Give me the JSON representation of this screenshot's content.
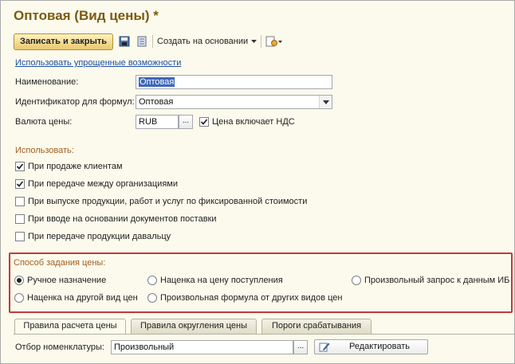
{
  "window": {
    "title": "Оптовая (Вид цены) *"
  },
  "toolbar": {
    "save_close_label": "Записать и закрыть",
    "create_based_label": "Создать на основании",
    "icons": [
      "save-icon",
      "list-icon",
      "create-based-dropdown-icon",
      "report-icon"
    ]
  },
  "simple_mode_link": "Использовать упрощенные возможности",
  "fields": {
    "name_label": "Наименование:",
    "name_value": "Оптовая",
    "formula_id_label": "Идентификатор для формул:",
    "formula_id_value": "Оптовая",
    "currency_label": "Валюта цены:",
    "currency_value": "RUB",
    "currency_dots": "...",
    "vat_label": "Цена включает НДС",
    "vat_checked": true
  },
  "use_section": {
    "title": "Использовать:",
    "items": [
      {
        "label": "При продаже клиентам",
        "checked": true
      },
      {
        "label": "При передаче между организациями",
        "checked": true
      },
      {
        "label": "При выпуске продукции, работ и услуг по фиксированной стоимости",
        "checked": false
      },
      {
        "label": "При вводе на основании документов поставки",
        "checked": false
      },
      {
        "label": "При передаче продукции давальцу",
        "checked": false
      }
    ]
  },
  "price_method": {
    "title": "Способ задания цены:",
    "options": [
      {
        "label": "Ручное назначение",
        "selected": true
      },
      {
        "label": "Наценка на цену поступления",
        "selected": false
      },
      {
        "label": "Произвольный запрос к данным ИБ",
        "selected": false
      },
      {
        "label": "Наценка на другой вид цен",
        "selected": false
      },
      {
        "label": "Произвольная формула от других видов цен",
        "selected": false
      }
    ]
  },
  "tabs": [
    {
      "label": "Правила расчета цены",
      "active": true
    },
    {
      "label": "Правила округления цены",
      "active": false
    },
    {
      "label": "Пороги срабатывания",
      "active": false
    }
  ],
  "filter": {
    "label": "Отбор номенклатуры:",
    "value": "Произвольный",
    "dots": "...",
    "edit_label": "Редактировать"
  },
  "colors": {
    "title": "#7a5a12",
    "section": "#a15f22",
    "highlight_border": "#c23a3a",
    "link": "#1e4fa3",
    "background": "#fbfaec"
  }
}
